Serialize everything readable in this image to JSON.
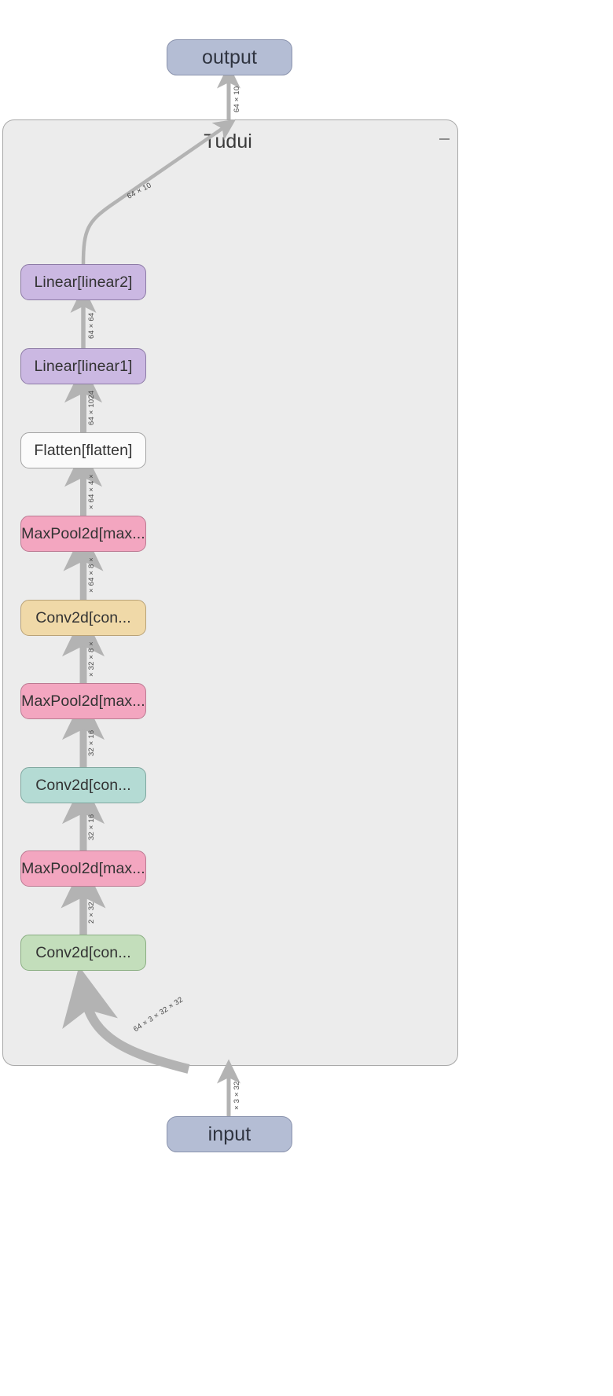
{
  "graph": {
    "title": "Tudui",
    "minimize_icon": "minimize-icon",
    "io_nodes": [
      {
        "id": "output",
        "label": "output"
      },
      {
        "id": "input",
        "label": "input"
      }
    ],
    "op_nodes": [
      {
        "id": "linear2",
        "label": "Linear[linear2]",
        "color": "#cbb8e2"
      },
      {
        "id": "linear1",
        "label": "Linear[linear1]",
        "color": "#cbb8e2"
      },
      {
        "id": "flatten",
        "label": "Flatten[flatten]",
        "color": "#fbfbfb"
      },
      {
        "id": "maxpool3",
        "label": "MaxPool2d[max...",
        "color": "#f3a6c0"
      },
      {
        "id": "conv3",
        "label": "Conv2d[con...",
        "color": "#f0d9a8"
      },
      {
        "id": "maxpool2",
        "label": "MaxPool2d[max...",
        "color": "#f3a6c0"
      },
      {
        "id": "conv2",
        "label": "Conv2d[con...",
        "color": "#b4dbd4"
      },
      {
        "id": "maxpool1",
        "label": "MaxPool2d[max...",
        "color": "#f3a6c0"
      },
      {
        "id": "conv1",
        "label": "Conv2d[con...",
        "color": "#c3debb"
      }
    ],
    "edge_labels": {
      "out_top": "64 × 10",
      "out_group": "64 × 10",
      "linear2_linear1": "64 × 64",
      "linear1_flatten": "64 × 1024",
      "flatten_maxpool3": "× 64 × 4 ×",
      "maxpool3_conv3": "× 64 × 8 ×",
      "conv3_maxpool2": "× 32 × 8 ×",
      "maxpool2_conv2": "32 × 16",
      "conv2_maxpool1": "32 × 16",
      "maxpool1_conv1": "2 × 32",
      "conv1_input": "64 × 3 × 32 × 32",
      "input_group": "× 3 × 32"
    },
    "colors": {
      "edge": "#b3b3b3",
      "group_fill": "#ececec",
      "group_border": "#a8a8a8",
      "io_fill": "#b4bdd4",
      "io_border": "#8a93ad",
      "canvas": "#ffffff"
    }
  }
}
